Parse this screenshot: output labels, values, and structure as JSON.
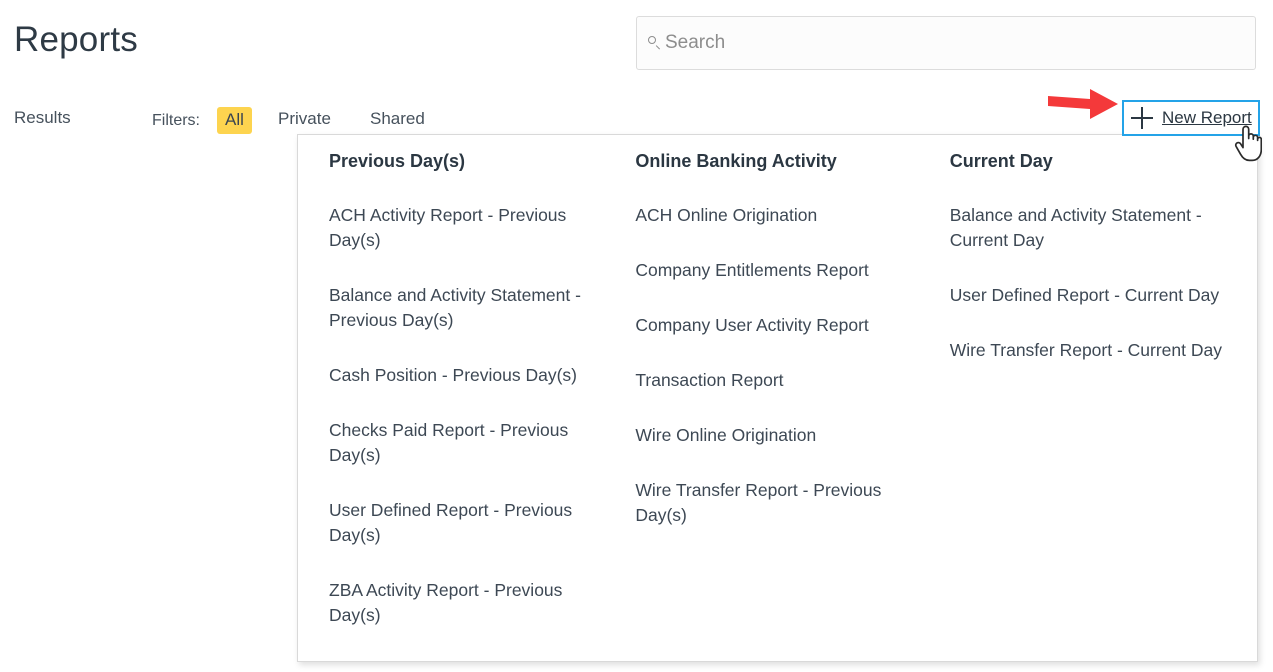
{
  "page": {
    "title": "Reports"
  },
  "search": {
    "icon": "search-icon",
    "placeholder": "Search",
    "value": ""
  },
  "toolbar": {
    "results_label": "Results",
    "filters_label": "Filters:",
    "filters": [
      {
        "label": "All",
        "selected": true
      },
      {
        "label": "Private",
        "selected": false
      },
      {
        "label": "Shared",
        "selected": false
      }
    ],
    "new_report": {
      "icon": "plus-icon",
      "label": "New Report",
      "expanded": true
    }
  },
  "annotations": {
    "arrow": "red-arrow-pointing-right",
    "cursor": "pointing-hand-cursor"
  },
  "report_menu": {
    "columns": [
      {
        "header": "Previous Day(s)",
        "items": [
          "ACH Activity Report - Previous Day(s)",
          "Balance and Activity Statement - Previous Day(s)",
          "Cash Position - Previous Day(s)",
          "Checks Paid Report - Previous Day(s)",
          "User Defined Report - Previous Day(s)",
          "ZBA Activity Report - Previous Day(s)"
        ]
      },
      {
        "header": "Online Banking Activity",
        "items": [
          "ACH Online Origination",
          "Company Entitlements Report",
          "Company User Activity Report",
          "Transaction Report",
          "Wire Online Origination",
          "Wire Transfer Report - Previous Day(s)"
        ]
      },
      {
        "header": "Current Day",
        "items": [
          "Balance and Activity Statement - Current Day",
          "User Defined Report - Current Day",
          "Wire Transfer Report - Current Day"
        ]
      }
    ]
  },
  "colors": {
    "accent_blue": "#24a3e8",
    "filter_selected_yellow": "#fdd44f",
    "arrow_red": "#f4393a",
    "text_dark": "#2b3742",
    "text_body": "#3d4854"
  }
}
